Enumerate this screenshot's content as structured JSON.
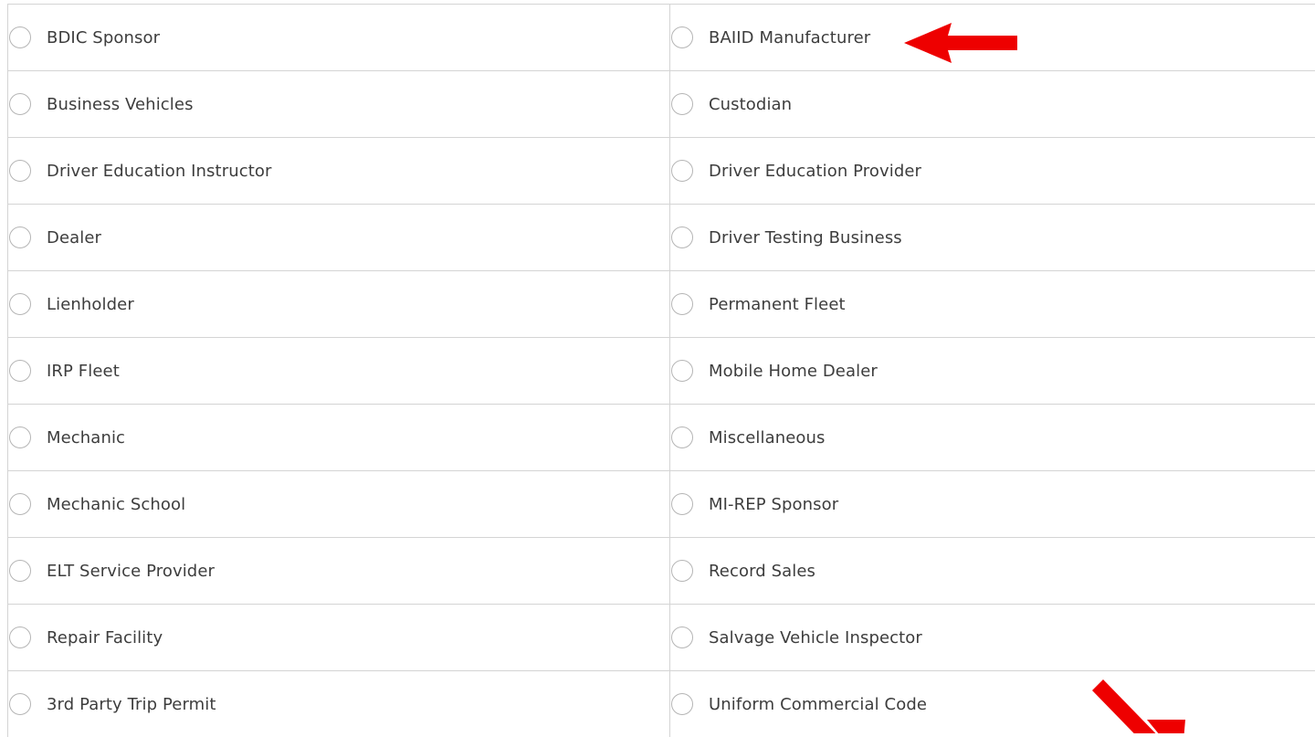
{
  "options": {
    "rows": [
      {
        "left": "BDIC Sponsor",
        "right": "BAIID Manufacturer"
      },
      {
        "left": "Business Vehicles",
        "right": "Custodian"
      },
      {
        "left": "Driver Education Instructor",
        "right": "Driver Education Provider"
      },
      {
        "left": "Dealer",
        "right": "Driver Testing Business"
      },
      {
        "left": "Lienholder",
        "right": "Permanent Fleet"
      },
      {
        "left": "IRP Fleet",
        "right": "Mobile Home Dealer"
      },
      {
        "left": "Mechanic",
        "right": "Miscellaneous"
      },
      {
        "left": "Mechanic School",
        "right": "MI-REP Sponsor"
      },
      {
        "left": "ELT Service Provider",
        "right": "Record Sales"
      },
      {
        "left": "Repair Facility",
        "right": "Salvage Vehicle Inspector"
      },
      {
        "left": "3rd Party Trip Permit",
        "right": "Uniform Commercial Code"
      }
    ]
  },
  "annotations": {
    "arrow_color": "#ee0000",
    "arrow_1_icon": "left-arrow-icon",
    "arrow_2_icon": "down-right-arrow-icon"
  }
}
